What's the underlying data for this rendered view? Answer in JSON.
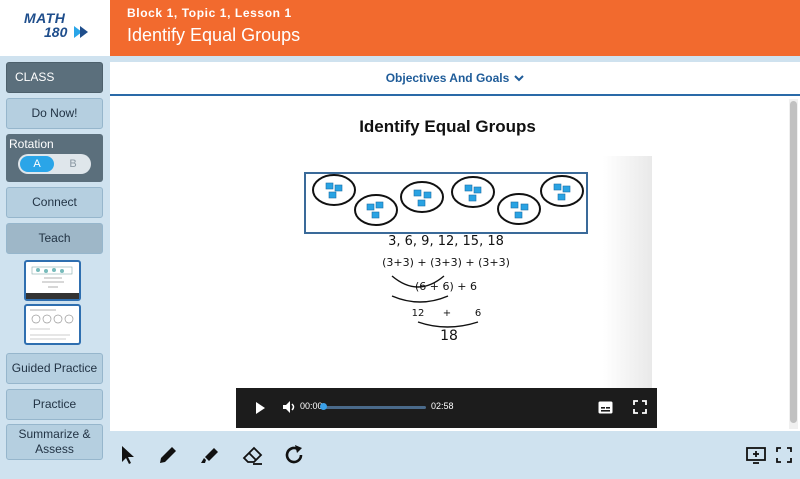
{
  "logo": {
    "line1": "MATH",
    "line2": "180"
  },
  "header": {
    "subtitle": "Block 1, Topic 1, Lesson 1",
    "title": "Identify Equal Groups",
    "color": "#f26a2e"
  },
  "sidebar": {
    "class_label": "CLASS",
    "do_now": "Do Now!",
    "rotation": {
      "label": "Rotation",
      "option_a": "A",
      "option_b": "B",
      "selected": "A"
    },
    "connect": "Connect",
    "teach": "Teach",
    "guided_practice": "Guided Practice",
    "practice": "Practice",
    "summarize": "Summarize & Assess"
  },
  "main": {
    "objectives": "Objectives And Goals",
    "title": "Identify Equal Groups"
  },
  "video": {
    "sequence": "3, 6, 9, 12, 15, 18",
    "groups_line": "(3+3) + (3+3) + (3+3)",
    "sums_line": "(6 + 6) + 6",
    "partial_a": "12",
    "plus": "+",
    "partial_b": "6",
    "total": "18",
    "current_time": "00:00",
    "duration": "02:58",
    "progress": 0
  },
  "toolbar": {
    "tools": [
      "pointer-icon",
      "pen-icon",
      "highlighter-icon",
      "eraser-icon",
      "redo-icon"
    ],
    "right": [
      "present-icon",
      "fullscreen-icon"
    ]
  }
}
